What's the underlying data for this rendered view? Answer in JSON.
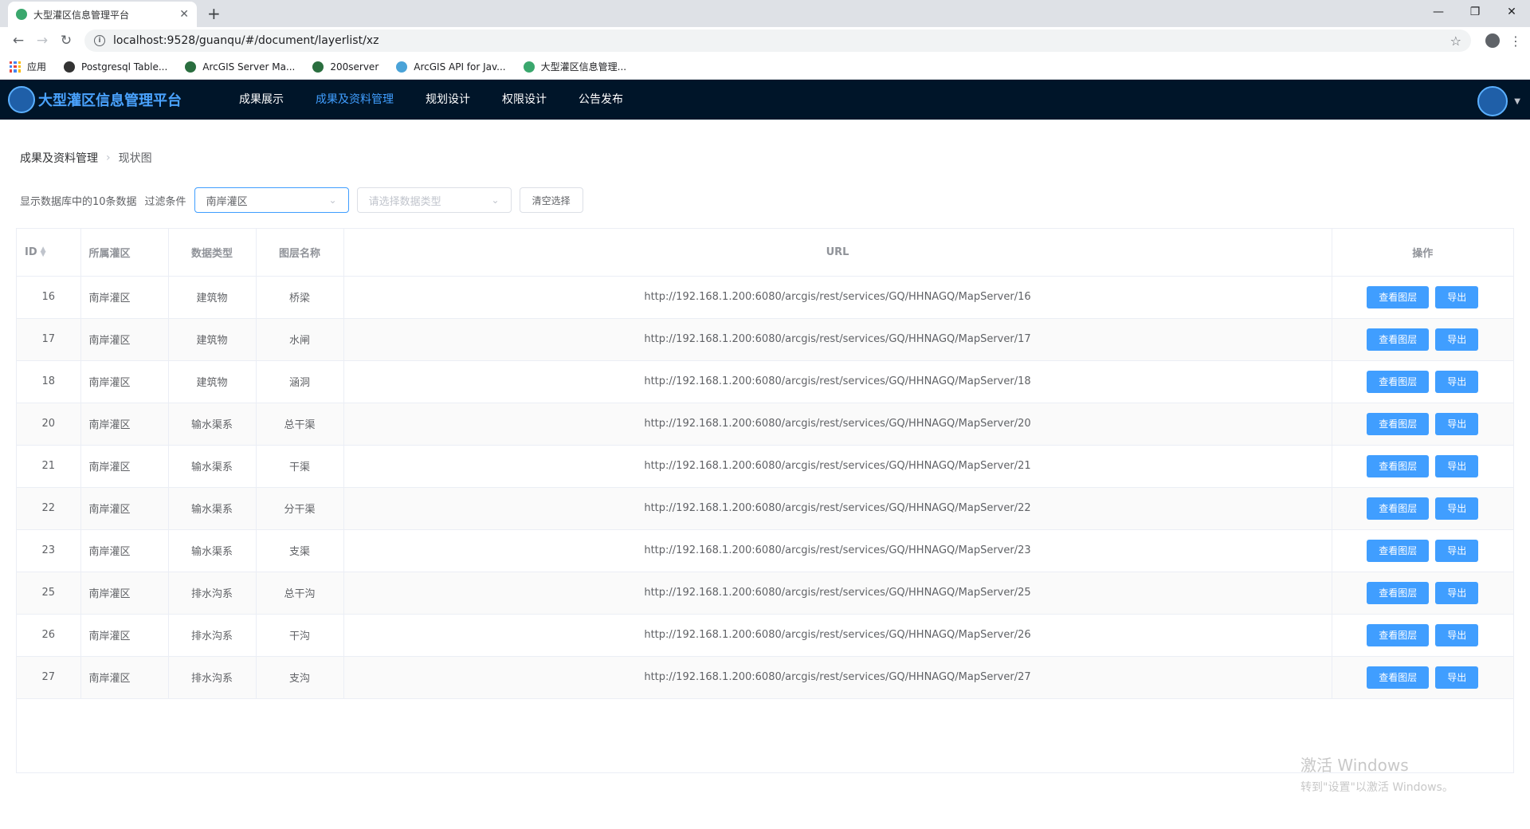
{
  "browser": {
    "tab_title": "大型灌区信息管理平台",
    "tab_close": "✕",
    "new_tab": "+",
    "url": "localhost:9528/guanqu/#/document/layerlist/xz",
    "window_controls": [
      "—",
      "❐",
      "✕"
    ],
    "bookmarks": [
      {
        "label": "应用",
        "icon": "apps-icon"
      },
      {
        "label": "Postgresql Table...",
        "icon": "globe-icon",
        "color": "#333333"
      },
      {
        "label": "ArcGIS Server Ma...",
        "icon": "globe-icon",
        "color": "#2a6e3f"
      },
      {
        "label": "200server",
        "icon": "globe-icon",
        "color": "#2a6e3f"
      },
      {
        "label": "ArcGIS API for Jav...",
        "icon": "arcgis-icon",
        "color": "#4aa3d8"
      },
      {
        "label": "大型灌区信息管理...",
        "icon": "vue-icon",
        "color": "#3aa76d"
      }
    ]
  },
  "header": {
    "title": "大型灌区信息管理平台",
    "nav": [
      {
        "label": "成果展示",
        "active": false
      },
      {
        "label": "成果及资料管理",
        "active": true
      },
      {
        "label": "规划设计",
        "active": false
      },
      {
        "label": "权限设计",
        "active": false
      },
      {
        "label": "公告发布",
        "active": false
      }
    ]
  },
  "breadcrumb": {
    "level1": "成果及资料管理",
    "level2": "现状图"
  },
  "filter": {
    "summary": "显示数据库中的10条数据",
    "label": "过滤条件",
    "area_value": "南岸灌区",
    "type_placeholder": "请选择数据类型",
    "clear_label": "清空选择"
  },
  "table": {
    "columns": [
      "ID",
      "所属灌区",
      "数据类型",
      "图层名称",
      "URL",
      "操作"
    ],
    "view_label": "查看图层",
    "export_label": "导出",
    "rows": [
      {
        "id": "16",
        "area": "南岸灌区",
        "type": "建筑物",
        "name": "桥梁",
        "url": "http://192.168.1.200:6080/arcgis/rest/services/GQ/HHNAGQ/MapServer/16"
      },
      {
        "id": "17",
        "area": "南岸灌区",
        "type": "建筑物",
        "name": "水闸",
        "url": "http://192.168.1.200:6080/arcgis/rest/services/GQ/HHNAGQ/MapServer/17"
      },
      {
        "id": "18",
        "area": "南岸灌区",
        "type": "建筑物",
        "name": "涵洞",
        "url": "http://192.168.1.200:6080/arcgis/rest/services/GQ/HHNAGQ/MapServer/18"
      },
      {
        "id": "20",
        "area": "南岸灌区",
        "type": "输水渠系",
        "name": "总干渠",
        "url": "http://192.168.1.200:6080/arcgis/rest/services/GQ/HHNAGQ/MapServer/20"
      },
      {
        "id": "21",
        "area": "南岸灌区",
        "type": "输水渠系",
        "name": "干渠",
        "url": "http://192.168.1.200:6080/arcgis/rest/services/GQ/HHNAGQ/MapServer/21"
      },
      {
        "id": "22",
        "area": "南岸灌区",
        "type": "输水渠系",
        "name": "分干渠",
        "url": "http://192.168.1.200:6080/arcgis/rest/services/GQ/HHNAGQ/MapServer/22"
      },
      {
        "id": "23",
        "area": "南岸灌区",
        "type": "输水渠系",
        "name": "支渠",
        "url": "http://192.168.1.200:6080/arcgis/rest/services/GQ/HHNAGQ/MapServer/23"
      },
      {
        "id": "25",
        "area": "南岸灌区",
        "type": "排水沟系",
        "name": "总干沟",
        "url": "http://192.168.1.200:6080/arcgis/rest/services/GQ/HHNAGQ/MapServer/25"
      },
      {
        "id": "26",
        "area": "南岸灌区",
        "type": "排水沟系",
        "name": "干沟",
        "url": "http://192.168.1.200:6080/arcgis/rest/services/GQ/HHNAGQ/MapServer/26"
      },
      {
        "id": "27",
        "area": "南岸灌区",
        "type": "排水沟系",
        "name": "支沟",
        "url": "http://192.168.1.200:6080/arcgis/rest/services/GQ/HHNAGQ/MapServer/27"
      }
    ]
  },
  "watermark": {
    "line1": "激活 Windows",
    "line2": "转到\"设置\"以激活 Windows。"
  },
  "colors": {
    "primary": "#409eff",
    "header_bg": "#001529",
    "title": "#4aa3ff"
  }
}
